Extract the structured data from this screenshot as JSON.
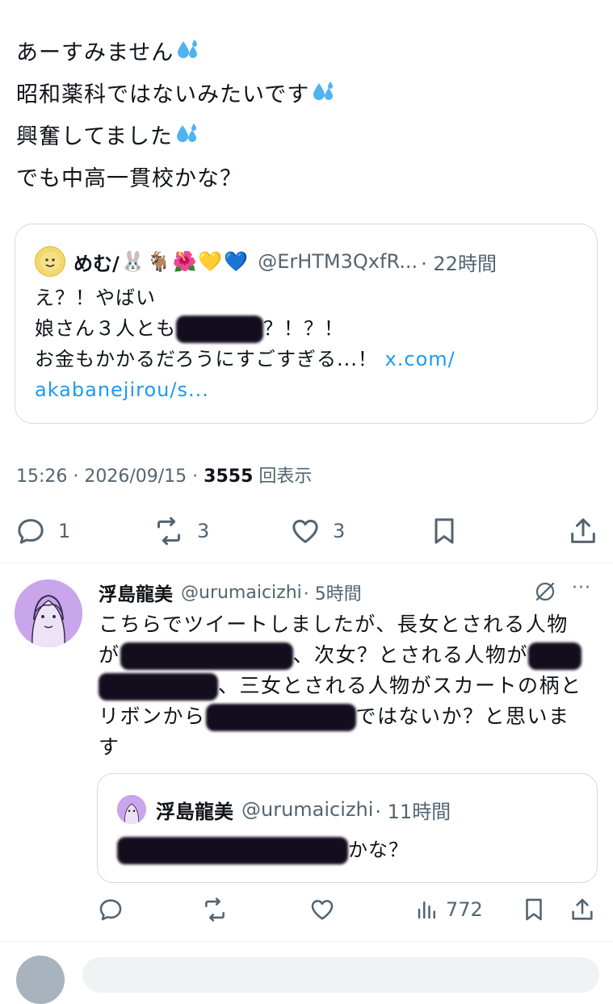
{
  "main_tweet": {
    "lines": [
      "あーすみません",
      "昭和薬科ではないみたいです",
      "興奮してました",
      "でも中高一貫校かな？"
    ]
  },
  "quoted_tweet": {
    "author_name": "めむ/",
    "author_emojis": "🐰🐐🌺💛💙",
    "handle": "@ErHTM3QxfR...",
    "time": "· 22時間",
    "line1": "え？！やばい",
    "line2_pre": "娘さん３人とも",
    "line2_post": "？！？！",
    "line3": "お金もかかるだろうにすごすぎる...！",
    "link_a": "x.com/",
    "link_b": "akabanejirou/s..."
  },
  "meta": {
    "time_date": "15:26 · 2026/09/15 · ",
    "views_count": "3555",
    "views_label": "回表示"
  },
  "actions": {
    "replies": "1",
    "retweets": "3",
    "likes": "3"
  },
  "reply": {
    "author_name": "浮島龍美",
    "handle": "@urumaicizhi",
    "time": "· 5時間",
    "more": "···",
    "l1": "こちらでツイートしましたが、長女とされる人物",
    "l2_a": "が",
    "l2_b": "、次女？とされる人物が",
    "l3_b": "、三女とされる人物がスカートの柄と",
    "l4_a": "リボンから",
    "l4_b": "ではないか？と思いま",
    "l5": "す",
    "views": "772"
  },
  "reply_quote": {
    "author_name": "浮島龍美",
    "handle": "@urumaicizhi",
    "time": "· 11時間",
    "text_post": "かな？"
  },
  "colors": {
    "text": "#0f1419",
    "muted": "#536471",
    "link": "#1d9bf0",
    "border": "#d4d9dd",
    "redaction": "#140d1e"
  }
}
